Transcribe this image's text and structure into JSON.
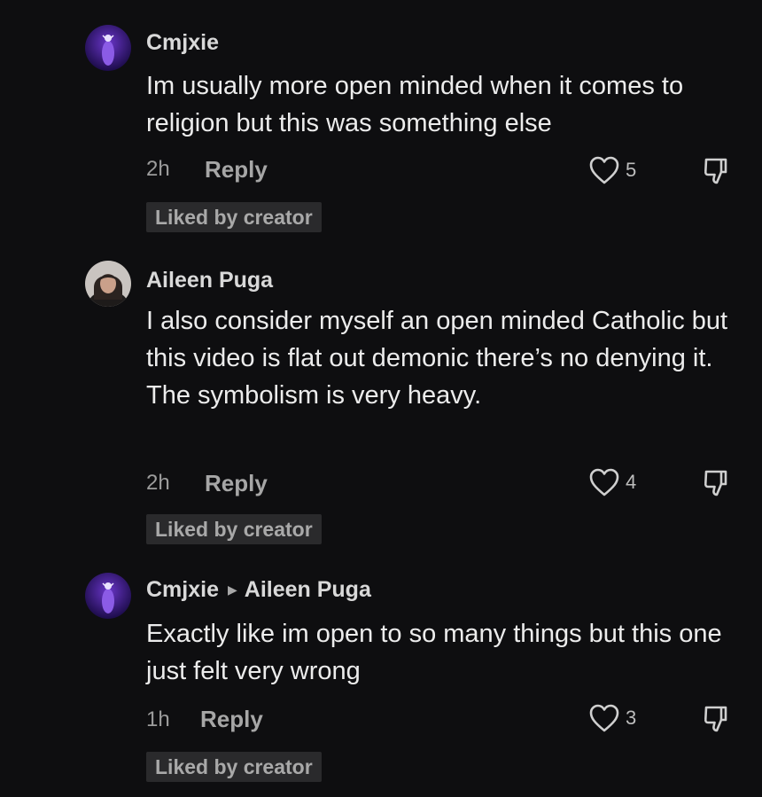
{
  "comments": [
    {
      "username": "Cmjxie",
      "text": "Im usually more open minded when it comes to religion but this was something else",
      "time": "2h",
      "reply_label": "Reply",
      "likes": "5",
      "badge": "Liked by creator",
      "avatar_icon": "purple-figure-avatar"
    },
    {
      "username": "Aileen Puga",
      "text": "I also consider myself an open minded Catholic but this video is flat out demonic there’s no denying it. The symbolism is very heavy.",
      "time": "2h",
      "reply_label": "Reply",
      "likes": "4",
      "badge": "Liked by creator",
      "avatar_icon": "portrait-avatar"
    },
    {
      "username": "Cmjxie",
      "reply_to": "Aileen Puga",
      "text": "Exactly like im open to so many things but this one just felt very wrong",
      "time": "1h",
      "reply_label": "Reply",
      "likes": "3",
      "badge": "Liked by creator",
      "avatar_icon": "purple-figure-avatar"
    }
  ],
  "colors": {
    "background": "#0e0e10",
    "text": "#ececec",
    "muted": "#9c9c9c",
    "badge_bg": "#2a2a2c"
  }
}
